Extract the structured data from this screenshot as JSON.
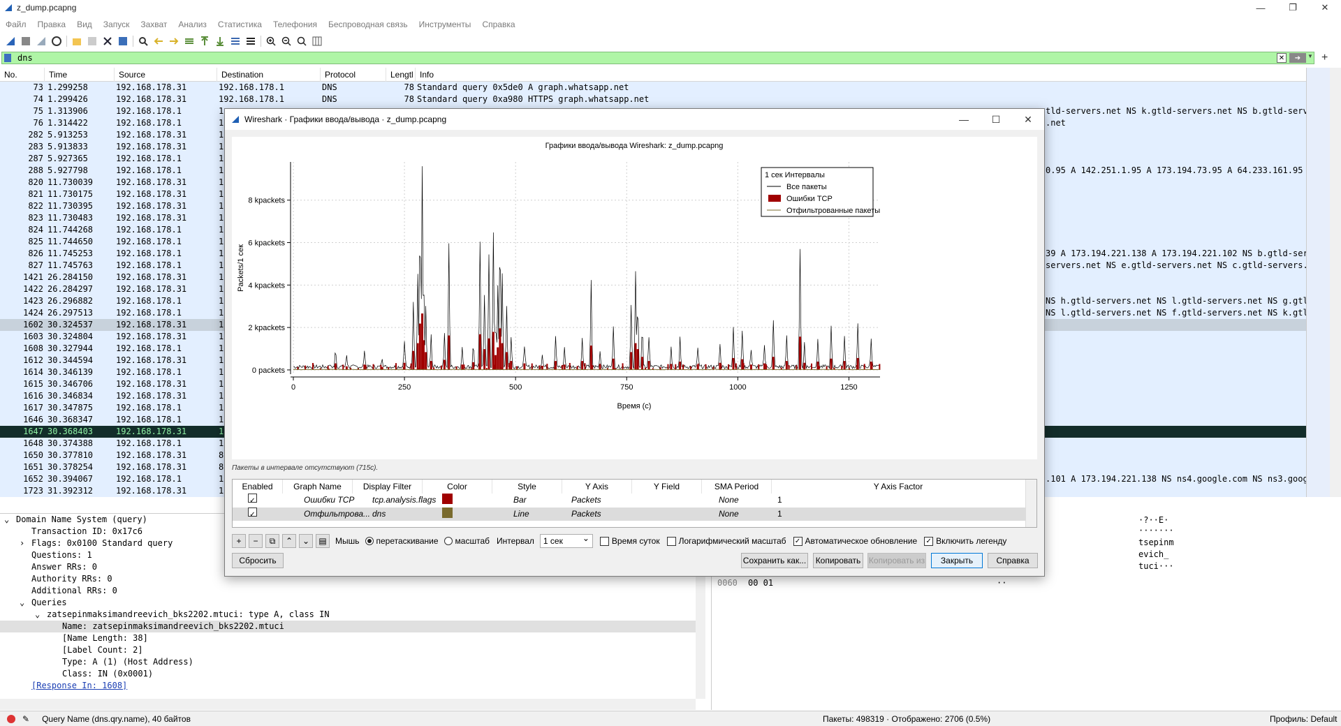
{
  "window": {
    "title": "z_dump.pcapng"
  },
  "menu": [
    "Файл",
    "Правка",
    "Вид",
    "Запуск",
    "Захват",
    "Анализ",
    "Статистика",
    "Телефония",
    "Беспроводная связь",
    "Инструменты",
    "Справка"
  ],
  "filter": {
    "value": "dns"
  },
  "packet_list": {
    "columns": [
      "No.",
      "Time",
      "Source",
      "Destination",
      "Protocol",
      "Lengtl",
      "Info"
    ],
    "rows": [
      {
        "no": "73",
        "time": "1.299258",
        "src": "192.168.178.31",
        "dst": "192.168.178.1",
        "proto": "DNS",
        "len": "78",
        "info": "Standard query 0x5de0 A graph.whatsapp.net"
      },
      {
        "no": "74",
        "time": "1.299426",
        "src": "192.168.178.31",
        "dst": "192.168.178.1",
        "proto": "DNS",
        "len": "78",
        "info": "Standard query 0xa980 HTTPS graph.whatsapp.net"
      },
      {
        "no": "75",
        "time": "1.313906",
        "src": "192.168.178.1",
        "dst": "1",
        "proto": "",
        "len": "",
        "info": "",
        "tail": "tld-servers.net NS k.gtld-servers.net NS b.gtld-server"
      },
      {
        "no": "76",
        "time": "1.314422",
        "src": "192.168.178.1",
        "dst": "1",
        "proto": "",
        "len": "",
        "info": "",
        "tail": ".net"
      },
      {
        "no": "282",
        "time": "5.913253",
        "src": "192.168.178.31",
        "dst": "1",
        "proto": "",
        "len": "",
        "info": "",
        "tail": ""
      },
      {
        "no": "283",
        "time": "5.913833",
        "src": "192.168.178.31",
        "dst": "1",
        "proto": "",
        "len": "",
        "info": "",
        "tail": ""
      },
      {
        "no": "287",
        "time": "5.927365",
        "src": "192.168.178.1",
        "dst": "1",
        "proto": "",
        "len": "",
        "info": "",
        "tail": ""
      },
      {
        "no": "288",
        "time": "5.927798",
        "src": "192.168.178.1",
        "dst": "1",
        "proto": "",
        "len": "",
        "info": "",
        "tail": "0.95 A 142.251.1.95 A 173.194.73.95 A 64.233.161.95 A"
      },
      {
        "no": "820",
        "time": "11.730039",
        "src": "192.168.178.31",
        "dst": "1",
        "proto": "",
        "len": "",
        "info": "",
        "tail": ""
      },
      {
        "no": "821",
        "time": "11.730175",
        "src": "192.168.178.31",
        "dst": "1",
        "proto": "",
        "len": "",
        "info": "",
        "tail": ""
      },
      {
        "no": "822",
        "time": "11.730395",
        "src": "192.168.178.31",
        "dst": "1",
        "proto": "",
        "len": "",
        "info": "",
        "tail": ""
      },
      {
        "no": "823",
        "time": "11.730483",
        "src": "192.168.178.31",
        "dst": "1",
        "proto": "",
        "len": "",
        "info": "",
        "tail": ""
      },
      {
        "no": "824",
        "time": "11.744268",
        "src": "192.168.178.1",
        "dst": "1",
        "proto": "",
        "len": "",
        "info": "",
        "tail": ""
      },
      {
        "no": "825",
        "time": "11.744650",
        "src": "192.168.178.1",
        "dst": "1",
        "proto": "",
        "len": "",
        "info": "",
        "tail": ""
      },
      {
        "no": "826",
        "time": "11.745253",
        "src": "192.168.178.1",
        "dst": "1",
        "proto": "",
        "len": "",
        "info": "",
        "tail": "39 A 173.194.221.138 A 173.194.221.102 NS b.gtld-serv"
      },
      {
        "no": "827",
        "time": "11.745763",
        "src": "192.168.178.1",
        "dst": "1",
        "proto": "",
        "len": "",
        "info": "",
        "tail": "servers.net NS e.gtld-servers.net NS c.gtld-servers.n"
      },
      {
        "no": "1421",
        "time": "26.284150",
        "src": "192.168.178.31",
        "dst": "1",
        "proto": "",
        "len": "",
        "info": "",
        "tail": ""
      },
      {
        "no": "1422",
        "time": "26.284297",
        "src": "192.168.178.31",
        "dst": "1",
        "proto": "",
        "len": "",
        "info": "",
        "tail": ""
      },
      {
        "no": "1423",
        "time": "26.296882",
        "src": "192.168.178.1",
        "dst": "1",
        "proto": "",
        "len": "",
        "info": "",
        "tail": "NS h.gtld-servers.net NS l.gtld-servers.net NS g.gtl"
      },
      {
        "no": "1424",
        "time": "26.297513",
        "src": "192.168.178.1",
        "dst": "1",
        "proto": "",
        "len": "",
        "info": "",
        "tail": "NS l.gtld-servers.net NS f.gtld-servers.net NS k.gtld"
      },
      {
        "no": "1602",
        "time": "30.324537",
        "src": "192.168.178.31",
        "dst": "1",
        "proto": "",
        "len": "",
        "info": "",
        "tail": "",
        "state": "grey"
      },
      {
        "no": "1603",
        "time": "30.324804",
        "src": "192.168.178.31",
        "dst": "1",
        "proto": "",
        "len": "",
        "info": "",
        "tail": ""
      },
      {
        "no": "1608",
        "time": "30.327944",
        "src": "192.168.178.1",
        "dst": "1",
        "proto": "",
        "len": "",
        "info": "",
        "tail": ""
      },
      {
        "no": "1612",
        "time": "30.344594",
        "src": "192.168.178.31",
        "dst": "1",
        "proto": "",
        "len": "",
        "info": "",
        "tail": ""
      },
      {
        "no": "1614",
        "time": "30.346139",
        "src": "192.168.178.1",
        "dst": "1",
        "proto": "",
        "len": "",
        "info": "",
        "tail": ""
      },
      {
        "no": "1615",
        "time": "30.346706",
        "src": "192.168.178.31",
        "dst": "1",
        "proto": "",
        "len": "",
        "info": "",
        "tail": ""
      },
      {
        "no": "1616",
        "time": "30.346834",
        "src": "192.168.178.31",
        "dst": "1",
        "proto": "",
        "len": "",
        "info": "",
        "tail": ""
      },
      {
        "no": "1617",
        "time": "30.347875",
        "src": "192.168.178.1",
        "dst": "1",
        "proto": "",
        "len": "",
        "info": "",
        "tail": ""
      },
      {
        "no": "1646",
        "time": "30.368347",
        "src": "192.168.178.1",
        "dst": "1",
        "proto": "",
        "len": "",
        "info": "",
        "tail": ""
      },
      {
        "no": "1647",
        "time": "30.368403",
        "src": "192.168.178.31",
        "dst": "1",
        "proto": "",
        "len": "",
        "info": "",
        "tail": "",
        "state": "black"
      },
      {
        "no": "1648",
        "time": "30.374388",
        "src": "192.168.178.1",
        "dst": "1",
        "proto": "",
        "len": "",
        "info": "",
        "tail": ""
      },
      {
        "no": "1650",
        "time": "30.377810",
        "src": "192.168.178.31",
        "dst": "8",
        "proto": "",
        "len": "",
        "info": "",
        "tail": ""
      },
      {
        "no": "1651",
        "time": "30.378254",
        "src": "192.168.178.31",
        "dst": "8",
        "proto": "",
        "len": "",
        "info": "",
        "tail": ""
      },
      {
        "no": "1652",
        "time": "30.394067",
        "src": "192.168.178.1",
        "dst": "1",
        "proto": "",
        "len": "",
        "info": "",
        "tail": ".101 A 173.194.221.138 NS ns4.google.com NS ns3.googl"
      },
      {
        "no": "1723",
        "time": "31.392312",
        "src": "192.168.178.31",
        "dst": "1",
        "proto": "",
        "len": "",
        "info": "",
        "tail": ""
      }
    ]
  },
  "details": {
    "lines": [
      {
        "indent": 0,
        "arrow": "v",
        "text": "Domain Name System (query)"
      },
      {
        "indent": 2,
        "arrow": "",
        "text": "Transaction ID: 0x17c6"
      },
      {
        "indent": 2,
        "arrow": ">",
        "text": "Flags: 0x0100 Standard query"
      },
      {
        "indent": 2,
        "arrow": "",
        "text": "Questions: 1"
      },
      {
        "indent": 2,
        "arrow": "",
        "text": "Answer RRs: 0"
      },
      {
        "indent": 2,
        "arrow": "",
        "text": "Authority RRs: 0"
      },
      {
        "indent": 2,
        "arrow": "",
        "text": "Additional RRs: 0"
      },
      {
        "indent": 2,
        "arrow": "v",
        "text": "Queries"
      },
      {
        "indent": 4,
        "arrow": "v",
        "text": "zatsepinmaksimandreevich_bks2202.mtuci: type A, class IN"
      },
      {
        "indent": 6,
        "arrow": "",
        "text": "Name: zatsepinmaksimandreevich_bks2202.mtuci",
        "sel": true
      },
      {
        "indent": 6,
        "arrow": "",
        "text": "[Name Length: 38]"
      },
      {
        "indent": 6,
        "arrow": "",
        "text": "[Label Count: 2]"
      },
      {
        "indent": 6,
        "arrow": "",
        "text": "Type: A (1) (Host Address)"
      },
      {
        "indent": 6,
        "arrow": "",
        "text": "Class: IN (0x0001)"
      },
      {
        "indent": 2,
        "arrow": "",
        "text": "[Response In: 1608]",
        "link": true
      }
    ]
  },
  "bytes": {
    "ascii_lines": [
      "·?··E·",
      "·······",
      "tsepinm",
      "evich_",
      "tuci···"
    ],
    "offset": "0060",
    "hex": "00 01",
    "ascii": "··"
  },
  "status": {
    "field": "Query Name (dns.qry.name), 40 байтов",
    "packets": "Пакеты: 498319 · Отображено: 2706 (0.5%)",
    "profile": "Профиль: Default"
  },
  "dialog": {
    "title": "Wireshark · Графики ввода/вывода · z_dump.pcapng",
    "missing_note": "Пакеты в интервале отсутствуют (715с).",
    "table_headers": [
      "Enabled",
      "Graph Name",
      "Display Filter",
      "Color",
      "Style",
      "Y Axis",
      "Y Field",
      "SMA Period",
      "Y Axis Factor"
    ],
    "graphs": [
      {
        "enabled": true,
        "name": "Ошибки TCP",
        "filter": "tcp.analysis.flags",
        "color": "#a00000",
        "style": "Bar",
        "y_axis": "Packets",
        "y_field": "",
        "sma": "None",
        "factor": "1"
      },
      {
        "enabled": true,
        "name": "Отфильтрова...",
        "filter": "dns",
        "color": "#7a6b2e",
        "style": "Line",
        "y_axis": "Packets",
        "y_field": "",
        "sma": "None",
        "factor": "1"
      }
    ],
    "controls": {
      "mouse_label": "Мышь",
      "drag_label": "перетаскивание",
      "zoom_label": "масштаб",
      "interval_label": "Интервал",
      "interval_value": "1 сек",
      "tod_label": "Время суток",
      "log_label": "Логарифмический масштаб",
      "auto_label": "Автоматическое обновление",
      "legend_label": "Включить легенду"
    },
    "buttons": {
      "reset": "Сбросить",
      "save": "Сохранить как...",
      "copy": "Копировать",
      "copy_from": "Копировать из",
      "close": "Закрыть",
      "help": "Справка"
    }
  },
  "chart_data": {
    "type": "line",
    "title": "Графики ввода/вывода Wireshark: z_dump.pcapng",
    "xlabel": "Время (с)",
    "ylabel": "Packets/1 сек",
    "xlim": [
      0,
      1320
    ],
    "ylim": [
      -200,
      9800
    ],
    "x_ticks": [
      0,
      250,
      500,
      750,
      1000,
      1250
    ],
    "y_ticks": [
      {
        "value": 0,
        "label": "0 packets"
      },
      {
        "value": 2000,
        "label": "2 kpackets"
      },
      {
        "value": 4000,
        "label": "4 kpackets"
      },
      {
        "value": 6000,
        "label": "6 kpackets"
      },
      {
        "value": 8000,
        "label": "8 kpackets"
      }
    ],
    "legend": {
      "title": "1 сек Интервалы",
      "placement": "top-right",
      "entries": [
        {
          "label": "Все пакеты",
          "color": "#000000",
          "kind": "line"
        },
        {
          "label": "Ошибки TCP",
          "color": "#a00000",
          "kind": "bar"
        },
        {
          "label": "Отфильтрованные пакеты",
          "color": "#7a6b2e",
          "kind": "line"
        }
      ]
    },
    "series": [
      {
        "name": "Все пакеты",
        "peaks": [
          [
            80,
            200
          ],
          [
            95,
            1000
          ],
          [
            120,
            600
          ],
          [
            160,
            900
          ],
          [
            200,
            500
          ],
          [
            250,
            1200
          ],
          [
            270,
            3200
          ],
          [
            280,
            4500
          ],
          [
            285,
            7800
          ],
          [
            290,
            9500
          ],
          [
            293,
            5000
          ],
          [
            298,
            3000
          ],
          [
            310,
            1500
          ],
          [
            340,
            1700
          ],
          [
            350,
            5800
          ],
          [
            380,
            900
          ],
          [
            405,
            1300
          ],
          [
            420,
            6000
          ],
          [
            430,
            3500
          ],
          [
            440,
            5300
          ],
          [
            450,
            6400
          ],
          [
            455,
            2500
          ],
          [
            460,
            3800
          ],
          [
            465,
            7000
          ],
          [
            470,
            4500
          ],
          [
            480,
            3000
          ],
          [
            490,
            1500
          ],
          [
            520,
            1100
          ],
          [
            560,
            700
          ],
          [
            590,
            1500
          ],
          [
            610,
            900
          ],
          [
            650,
            1500
          ],
          [
            670,
            4100
          ],
          [
            690,
            800
          ],
          [
            720,
            1900
          ],
          [
            760,
            3000
          ],
          [
            770,
            4500
          ],
          [
            775,
            3500
          ],
          [
            785,
            2200
          ],
          [
            800,
            1500
          ],
          [
            850,
            1000
          ],
          [
            870,
            1400
          ],
          [
            910,
            900
          ],
          [
            960,
            1200
          ],
          [
            990,
            2000
          ],
          [
            1010,
            1800
          ],
          [
            1030,
            900
          ],
          [
            1060,
            1100
          ],
          [
            1080,
            2200
          ],
          [
            1110,
            1500
          ],
          [
            1140,
            5600
          ],
          [
            1150,
            1200
          ],
          [
            1180,
            1400
          ],
          [
            1210,
            1900
          ],
          [
            1240,
            1500
          ],
          [
            1270,
            2000
          ],
          [
            1300,
            1400
          ]
        ]
      }
    ]
  }
}
